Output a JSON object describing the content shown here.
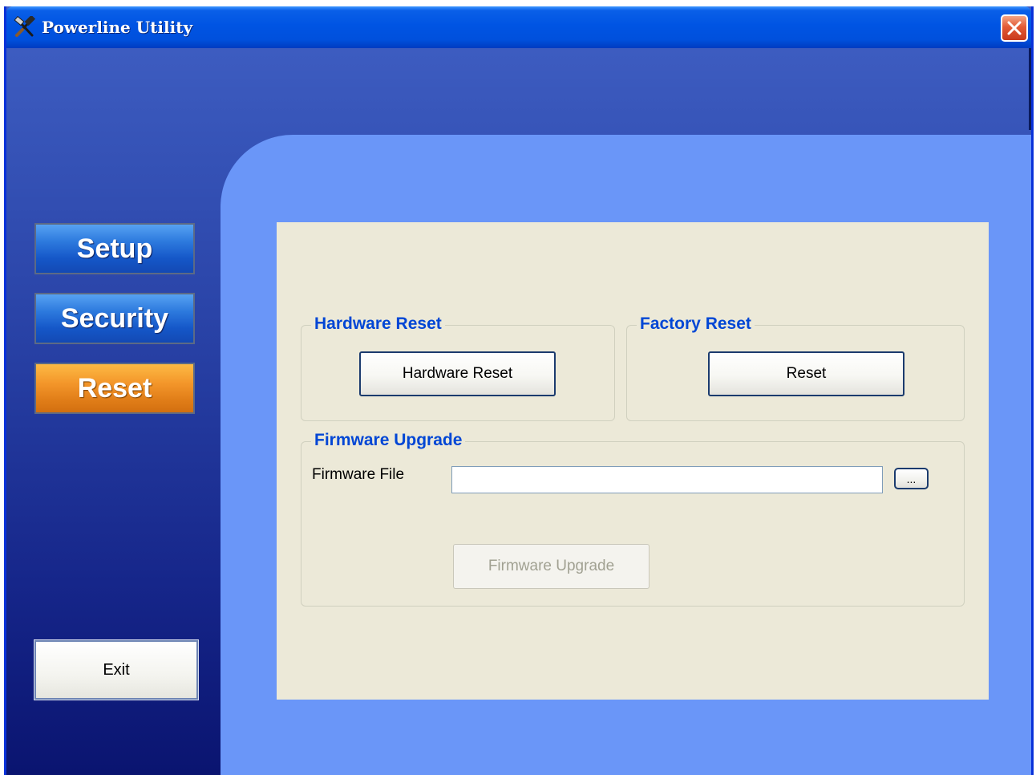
{
  "window": {
    "title": "Powerline Utility",
    "title_icon": "tools-icon",
    "close_icon": "close-icon"
  },
  "sidebar": {
    "items": [
      {
        "label": "Setup",
        "active": false
      },
      {
        "label": "Security",
        "active": false
      },
      {
        "label": "Reset",
        "active": true
      }
    ],
    "exit_label": "Exit"
  },
  "hardware_reset": {
    "legend": "Hardware Reset",
    "button_label": "Hardware Reset"
  },
  "factory_reset": {
    "legend": "Factory Reset",
    "button_label": "Reset"
  },
  "firmware_upgrade": {
    "legend": "Firmware Upgrade",
    "file_label": "Firmware File",
    "file_value": "",
    "browse_label": "...",
    "upgrade_label": "Firmware Upgrade",
    "upgrade_enabled": false
  },
  "colors": {
    "nav_blue": "#1557c8",
    "nav_active": "#f3962a",
    "legend_text": "#0046d5",
    "form_background": "#ece9d8",
    "content_panel": "#6a96f8"
  }
}
